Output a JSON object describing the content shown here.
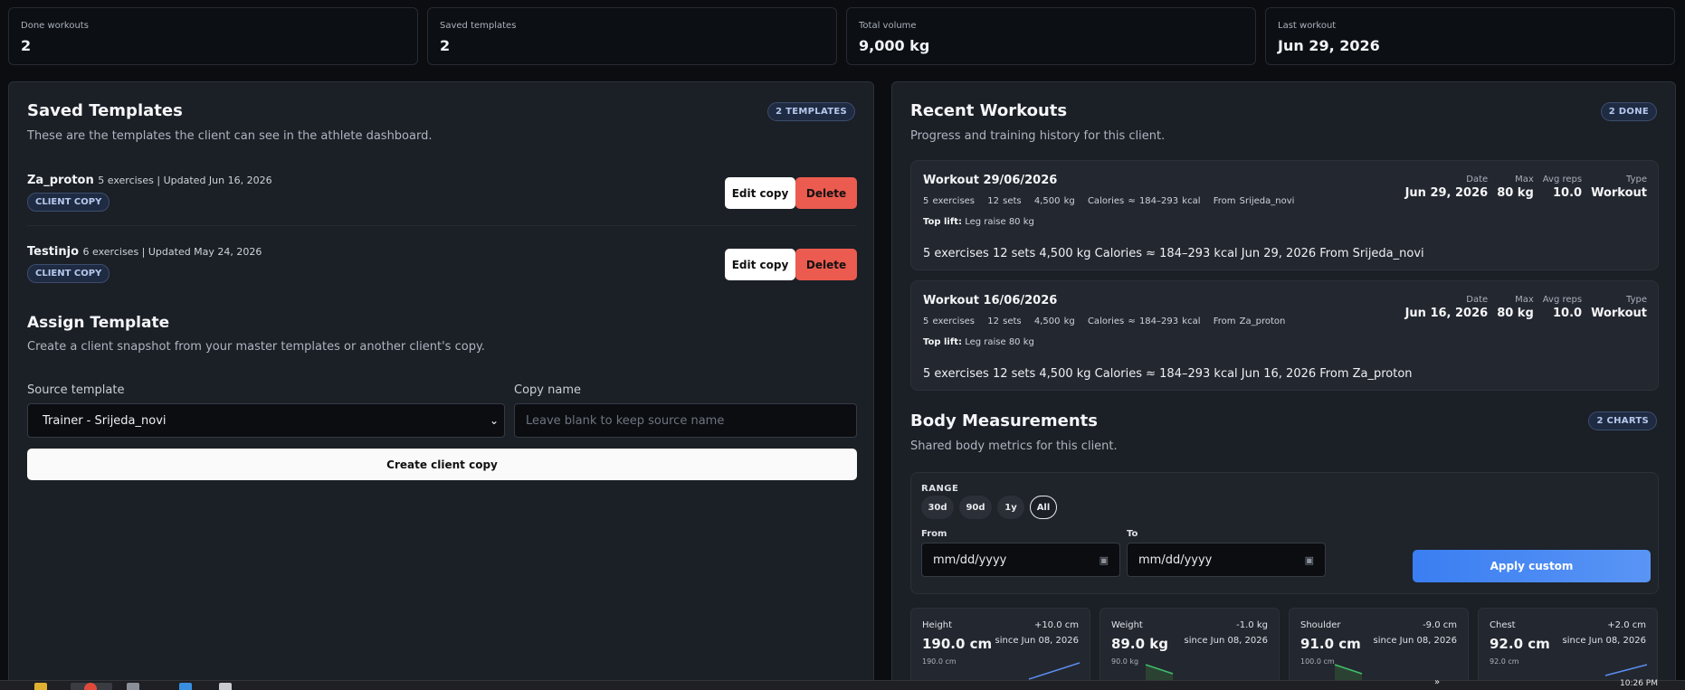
{
  "stats": [
    {
      "label": "Done workouts",
      "value": "2"
    },
    {
      "label": "Saved templates",
      "value": "2"
    },
    {
      "label": "Total volume",
      "value": "9,000 kg"
    },
    {
      "label": "Last workout",
      "value": "Jun 29, 2026"
    }
  ],
  "templates": {
    "title": "Saved Templates",
    "subtitle": "These are the templates the client can see in the athlete dashboard.",
    "badge": "2 TEMPLATES",
    "edit_label": "Edit copy",
    "delete_label": "Delete",
    "items": [
      {
        "name": "Za_proton",
        "meta": "5 exercises | Updated Jun 16, 2026",
        "tag": "CLIENT COPY"
      },
      {
        "name": "Testinjo",
        "meta": "6 exercises | Updated May 24, 2026",
        "tag": "CLIENT COPY"
      }
    ]
  },
  "assign": {
    "title": "Assign Template",
    "subtitle": "Create a client snapshot from your master templates or another client's copy.",
    "source_label": "Source template",
    "source_value": "Trainer - Srijeda_novi",
    "copy_label": "Copy name",
    "copy_placeholder": "Leave blank to keep source name",
    "create_label": "Create client copy"
  },
  "workouts": {
    "title": "Recent Workouts",
    "subtitle": "Progress and training history for this client.",
    "badge": "2 DONE",
    "col_labels": {
      "date": "Date",
      "max": "Max",
      "avg": "Avg reps",
      "type": "Type"
    },
    "top_lift_label": "Top lift:",
    "items": [
      {
        "title": "Workout 29/06/2026",
        "exercises": "5 exercises",
        "sets": "12 sets",
        "volume": "4,500 kg",
        "calories": "Calories ≈ 184–293 kcal",
        "from": "From Srijeda_novi",
        "top_lift": "Leg raise 80 kg",
        "summary": "5 exercises 12 sets 4,500 kg Calories ≈ 184–293 kcal Jun 29, 2026 From Srijeda_novi",
        "date": "Jun 29, 2026",
        "max": "80 kg",
        "avg": "10.0",
        "type": "Workout"
      },
      {
        "title": "Workout 16/06/2026",
        "exercises": "5 exercises",
        "sets": "12 sets",
        "volume": "4,500 kg",
        "calories": "Calories ≈ 184–293 kcal",
        "from": "From Za_proton",
        "top_lift": "Leg raise 80 kg",
        "summary": "5 exercises 12 sets 4,500 kg Calories ≈ 184–293 kcal Jun 16, 2026 From Za_proton",
        "date": "Jun 16, 2026",
        "max": "80 kg",
        "avg": "10.0",
        "type": "Workout"
      }
    ]
  },
  "body": {
    "title": "Body Measurements",
    "subtitle": "Shared body metrics for this client.",
    "badge": "2 CHARTS",
    "range_label": "RANGE",
    "chips": [
      "30d",
      "90d",
      "1y",
      "All"
    ],
    "active_chip": "All",
    "from_label": "From",
    "to_label": "To",
    "date_placeholder": "mm/dd/yyyy",
    "apply_label": "Apply custom",
    "metrics": [
      {
        "name": "Height",
        "delta": "+10.0 cm",
        "value": "190.0 cm",
        "since": "since Jun 08, 2026",
        "base": "190.0 cm",
        "trend": "up",
        "color": "#5b8def"
      },
      {
        "name": "Weight",
        "delta": "-1.0 kg",
        "value": "89.0 kg",
        "since": "since Jun 08, 2026",
        "base": "90.0 kg",
        "trend": "down",
        "color": "#3fbf6a"
      },
      {
        "name": "Shoulder",
        "delta": "-9.0 cm",
        "value": "91.0 cm",
        "since": "since Jun 08, 2026",
        "base": "100.0 cm",
        "trend": "down",
        "color": "#3fbf6a"
      },
      {
        "name": "Chest",
        "delta": "+2.0 cm",
        "value": "92.0 cm",
        "since": "since Jun 08, 2026",
        "base": "92.0 cm",
        "trend": "up",
        "color": "#5b8def"
      }
    ]
  },
  "taskbar": {
    "time": "10:26 PM",
    "overflow": "»"
  }
}
